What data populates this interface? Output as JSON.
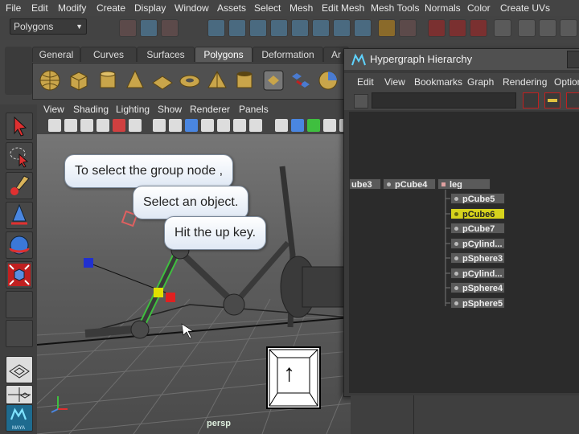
{
  "menubar": {
    "items": [
      "File",
      "Edit",
      "Modify",
      "Create",
      "Display",
      "Window",
      "Assets",
      "Select",
      "Mesh",
      "Edit Mesh",
      "Mesh Tools",
      "Normals",
      "Color",
      "Create UVs"
    ]
  },
  "statusline": {
    "mode": "Polygons"
  },
  "shelf": {
    "tabs": [
      "General",
      "Curves",
      "Surfaces",
      "Polygons",
      "Deformation",
      "Ar"
    ],
    "active_tab": "Polygons"
  },
  "panel": {
    "menu": [
      "View",
      "Shading",
      "Lighting",
      "Show",
      "Renderer",
      "Panels"
    ],
    "camera_label": "persp"
  },
  "tutorial": {
    "bubble_1": "To select the group node ,",
    "bubble_2": "Select an object.",
    "bubble_3": "Hit the up key.",
    "key_symbol": "↑"
  },
  "hypergraph": {
    "title": "Hypergraph Hierarchy",
    "menu": [
      "Edit",
      "View",
      "Bookmarks",
      "Graph",
      "Rendering",
      "Option"
    ],
    "top_nodes": [
      "ube3",
      "pCube4",
      "leg"
    ],
    "child_nodes": [
      "pCube5",
      "pCube6",
      "pCube7",
      "pCylind...",
      "pSphere3",
      "pCylind...",
      "pSphere4",
      "pSphere5"
    ],
    "selected_node": "pCube6"
  },
  "colors": {
    "accent_red": "#c02020",
    "selected_node": "#d6d21c",
    "highlight_green": "#3fbf3f"
  },
  "logo_text": "MAYA"
}
